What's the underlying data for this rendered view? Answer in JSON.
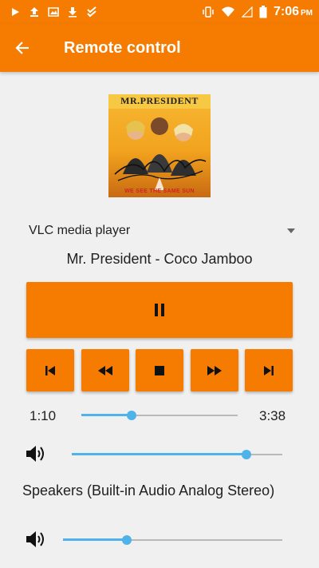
{
  "status_bar": {
    "time": "7:06",
    "ampm": "PM",
    "icons": [
      "play-icon",
      "upload-icon",
      "image-icon",
      "download-icon",
      "task-icon",
      "vibrate-icon",
      "wifi-icon",
      "signal-icon",
      "battery-icon"
    ]
  },
  "app_bar": {
    "title": "Remote control",
    "back_icon": "arrow-back-icon"
  },
  "album": {
    "artist_lettering": "MR.PRESIDENT",
    "tagline": "WE SEE THE SAME SUN"
  },
  "player": {
    "selected": "VLC media player",
    "track_title": "Mr. President - Coco Jamboo"
  },
  "controls": {
    "main": "pause-icon",
    "row": [
      "skip-previous-icon",
      "rewind-icon",
      "stop-icon",
      "fast-forward-icon",
      "skip-next-icon"
    ]
  },
  "progress": {
    "elapsed": "1:10",
    "duration": "3:38",
    "fraction": 0.32
  },
  "volume": {
    "level": 0.83
  },
  "output": {
    "device": "Speakers (Built-in Audio Analog Stereo)",
    "level": 0.29
  },
  "colors": {
    "accent": "#f57c00",
    "slider": "#4fb3ea",
    "background": "#f0f0f0"
  }
}
